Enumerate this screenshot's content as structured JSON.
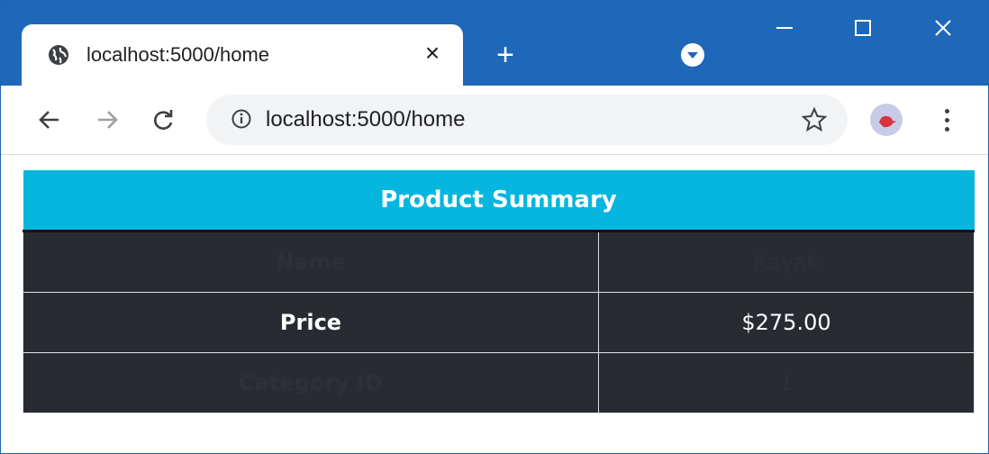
{
  "browser": {
    "tab_title": "localhost:5000/home",
    "url": "localhost:5000/home",
    "new_tab_label": "+",
    "close_tab_label": "×"
  },
  "table": {
    "header": "Product Summary",
    "rows": [
      {
        "label": "Name",
        "value": "Kayak"
      },
      {
        "label": "Price",
        "value": "$275.00"
      },
      {
        "label": "Category ID",
        "value": "1"
      }
    ]
  },
  "colors": {
    "title_bar": "#1f67b8",
    "table_header": "#06b6de",
    "table_body": "#282c32"
  }
}
